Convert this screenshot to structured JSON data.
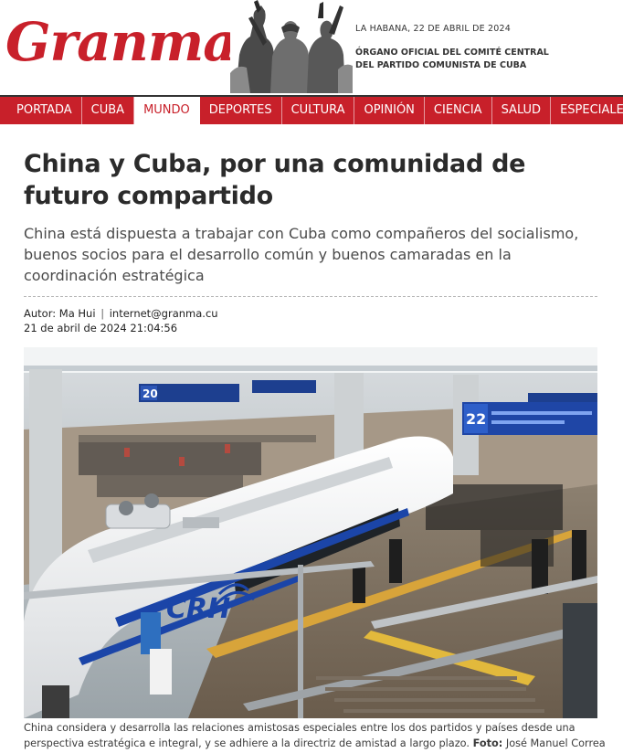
{
  "header": {
    "logo_text": "Granma",
    "date": "LA HABANA, 22 DE ABRIL DE 2024",
    "organ_line1": "ÓRGANO OFICIAL DEL COMITÉ CENTRAL",
    "organ_line2": "DEL PARTIDO COMUNISTA DE CUBA"
  },
  "nav": {
    "items": [
      "PORTADA",
      "CUBA",
      "MUNDO",
      "DEPORTES",
      "CULTURA",
      "OPINIÓN",
      "CIENCIA",
      "SALUD",
      "ESPECIALES"
    ],
    "active": "MUNDO"
  },
  "article": {
    "headline": "China y Cuba, por una comunidad de futuro compartido",
    "summary": "China está dispuesta a trabajar con Cuba como compañeros del socialismo, buenos socios para el desarrollo común y buenos camaradas en la coordinación estratégica",
    "author_label": "Autor:",
    "author": "Ma Hui",
    "author_email": "internet@granma.cu",
    "datetime": "21 de abril de 2024 21:04:56"
  },
  "photo": {
    "sign_left_number": "20",
    "sign_right_number": "22",
    "train_logo": "CRH",
    "caption": "China considera y desarrolla las relaciones amistosas especiales entre los dos partidos y países desde una perspectiva estratégica e integral, y se adhiere a la directriz de amistad a largo plazo.",
    "credit_label": "Foto:",
    "credit": "José Manuel Correa"
  },
  "colors": {
    "brand_red": "#c8202a",
    "nav_border": "#333333",
    "headline": "#2b2b2b"
  }
}
